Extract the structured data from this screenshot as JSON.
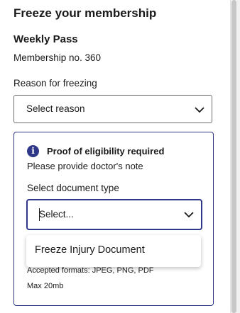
{
  "panel": {
    "title": "Freeze your membership",
    "pass_name": "Weekly Pass",
    "membership_number": "Membership no. 360"
  },
  "reason": {
    "label": "Reason for freezing",
    "selected": "Select reason"
  },
  "eligibility": {
    "icon": "info-icon",
    "icon_glyph": "i",
    "heading": "Proof of eligibility required",
    "subtext": "Please provide doctor's note",
    "document_type_label": "Select document type",
    "document_type_selected": "Select...",
    "accepted_formats": "Accepted formats: JPEG, PNG, PDF",
    "max_size": "Max 20mb"
  },
  "dropdown": {
    "options": [
      "Freeze Injury Document"
    ]
  },
  "colors": {
    "accent": "#2e3788",
    "text": "#1a1a1a",
    "border": "#6e6e6e"
  }
}
